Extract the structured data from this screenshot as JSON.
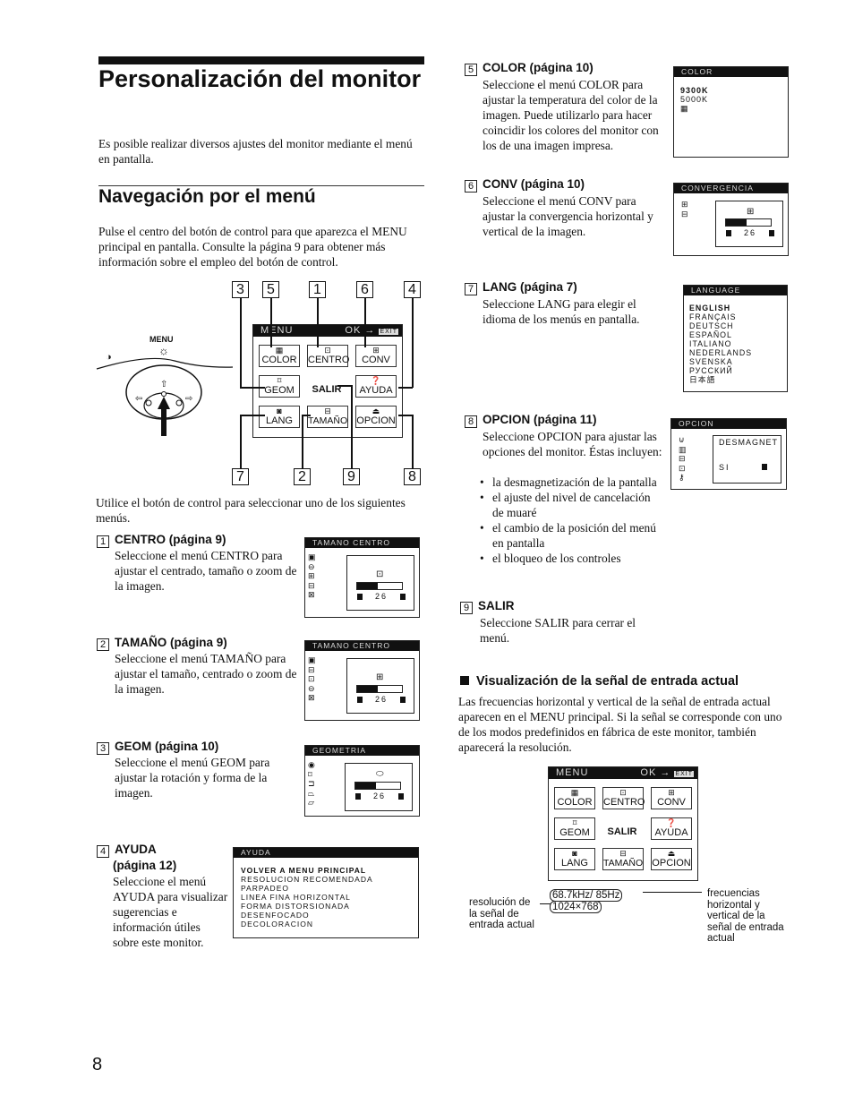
{
  "page": {
    "title": "Personalización del monitor",
    "intro": "Es posible realizar diversos ajustes del monitor mediante el menú en pantalla.",
    "section_title": "Navegación por el menú",
    "section_intro": "Pulse el centro del botón de control para que aparezca el MENU principal en pantalla. Consulte la página 9 para obtener más información sobre el empleo del botón de control.",
    "after_diagram": "Utilice el botón de control para seleccionar uno de los siguientes menús.",
    "page_number": "8"
  },
  "control": {
    "menu_label": "MENU",
    "icons": [
      "brightness-icon",
      "contrast-icon",
      "up-arrow-icon",
      "left-arrow-icon",
      "right-arrow-icon",
      "press-arrow-icon"
    ]
  },
  "main_menu": {
    "header_left": "MENU",
    "header_right": "OK →",
    "header_icon": "exit-icon",
    "items": [
      {
        "label": "COLOR",
        "icon": "▦"
      },
      {
        "label": "CENTRO",
        "icon": "⊡"
      },
      {
        "label": "CONV",
        "icon": "⊞"
      },
      {
        "label": "GEOM",
        "icon": "⌑"
      },
      {
        "label": "SALIR",
        "icon": ""
      },
      {
        "label": "AYUDA",
        "icon": "❓"
      },
      {
        "label": "LANG",
        "icon": "◙"
      },
      {
        "label": "TAMAÑO",
        "icon": "⊟"
      },
      {
        "label": "OPCION",
        "icon": "⏏"
      }
    ],
    "callouts": [
      "3",
      "5",
      "1",
      "6",
      "4",
      "7",
      "2",
      "9",
      "8"
    ]
  },
  "sections": [
    {
      "num": "1",
      "title": "CENTRO (página 9)",
      "text": "Seleccione el menú CENTRO para ajustar el centrado, tamaño o zoom de la imagen.",
      "osd": {
        "header": "TAMANO CENTRO",
        "value": "26",
        "progress": 0.45,
        "icons": [
          "▣",
          "⊖",
          "⊞",
          "⊟",
          "⊠"
        ],
        "sub_icon": "⊡"
      }
    },
    {
      "num": "2",
      "title": "TAMAÑO (página 9)",
      "text": "Seleccione el menú TAMAÑO para ajustar el tamaño, centrado o zoom de la imagen.",
      "osd": {
        "header": "TAMANO CENTRO",
        "value": "26",
        "progress": 0.45,
        "icons": [
          "▣",
          "⊟",
          "⊡",
          "⊖",
          "⊠"
        ],
        "sub_icon": "⊞"
      }
    },
    {
      "num": "3",
      "title": "GEOM (página 10)",
      "text": "Seleccione el menú GEOM para ajustar la rotación y forma de la imagen.",
      "osd": {
        "header": "GEOMETRIA",
        "value": "26",
        "progress": 0.45,
        "icons": [
          "◉",
          "⌑",
          "⊐",
          "⏢",
          "⏥"
        ],
        "sub_icon": "⬭"
      }
    },
    {
      "num": "4",
      "title": "AYUDA",
      "subtitle": "(página 12)",
      "text": "Seleccione el menú AYUDA para visualizar sugerencias e información útiles sobre este monitor.",
      "osd": {
        "header": "AYUDA",
        "items": [
          "VOLVER A MENU PRINCIPAL",
          "RESOLUCION RECOMENDADA",
          "PARPADEO",
          "LINEA FINA HORIZONTAL",
          "FORMA DISTORSIONADA",
          "DESENFOCADO",
          "DECOLORACION"
        ]
      }
    },
    {
      "num": "5",
      "title": "COLOR (página 10)",
      "text": "Seleccione el menú COLOR para ajustar la temperatura del color de la imagen. Puede utilizarlo para hacer coincidir los colores del monitor con los de una imagen impresa.",
      "osd": {
        "header": "COLOR",
        "items": [
          "9300K",
          "5000K",
          "▦"
        ]
      }
    },
    {
      "num": "6",
      "title": "CONV (página 10)",
      "text": "Seleccione el menú CONV para ajustar la convergencia horizontal y vertical de la imagen.",
      "osd": {
        "header": "CONVERGENCIA",
        "value": "26",
        "progress": 0.45,
        "icons": [
          "⊞",
          "⊟"
        ],
        "sub_icon": "⊞"
      }
    },
    {
      "num": "7",
      "title": "LANG (página 7)",
      "text": "Seleccione LANG para elegir el idioma de los menús en pantalla.",
      "osd": {
        "header": "LANGUAGE",
        "items": [
          "ENGLISH",
          "FRANÇAIS",
          "DEUTSCH",
          "ESPAÑOL",
          "ITALIANO",
          "NEDERLANDS",
          "SVENSKA",
          "РУССКИЙ",
          "日本語"
        ]
      }
    },
    {
      "num": "8",
      "title": "OPCION (página 11)",
      "text": "Seleccione OPCION para ajustar las opciones del monitor. Éstas incluyen:",
      "bullets": [
        "la desmagnetización de la pantalla",
        "el ajuste del nivel de cancelación de muaré",
        "el cambio de la posición del menú en pantalla",
        "el bloqueo de los controles"
      ],
      "osd": {
        "header": "OPCION",
        "sub_title": "DESMAGNET",
        "sub_value": "SI",
        "icons": [
          "⊍",
          "▥",
          "⊟",
          "⊡",
          "⚷"
        ]
      }
    },
    {
      "num": "9",
      "title": "SALIR",
      "text": "Seleccione SALIR para cerrar el menú."
    }
  ],
  "signal": {
    "title": "Visualización de la señal de entrada actual",
    "text": "Las frecuencias horizontal y vertical de la señal de entrada actual aparecen en el MENU principal. Si la señal se corresponde con uno de los modos predefinidos en fábrica de este monitor, también aparecerá la resolución.",
    "frequency": "68.7kHz/ 85Hz",
    "resolution": "1024×768",
    "label_left": "resolución de la señal de entrada actual",
    "label_right": "frecuencias horizontal y vertical de la señal de entrada actual"
  }
}
